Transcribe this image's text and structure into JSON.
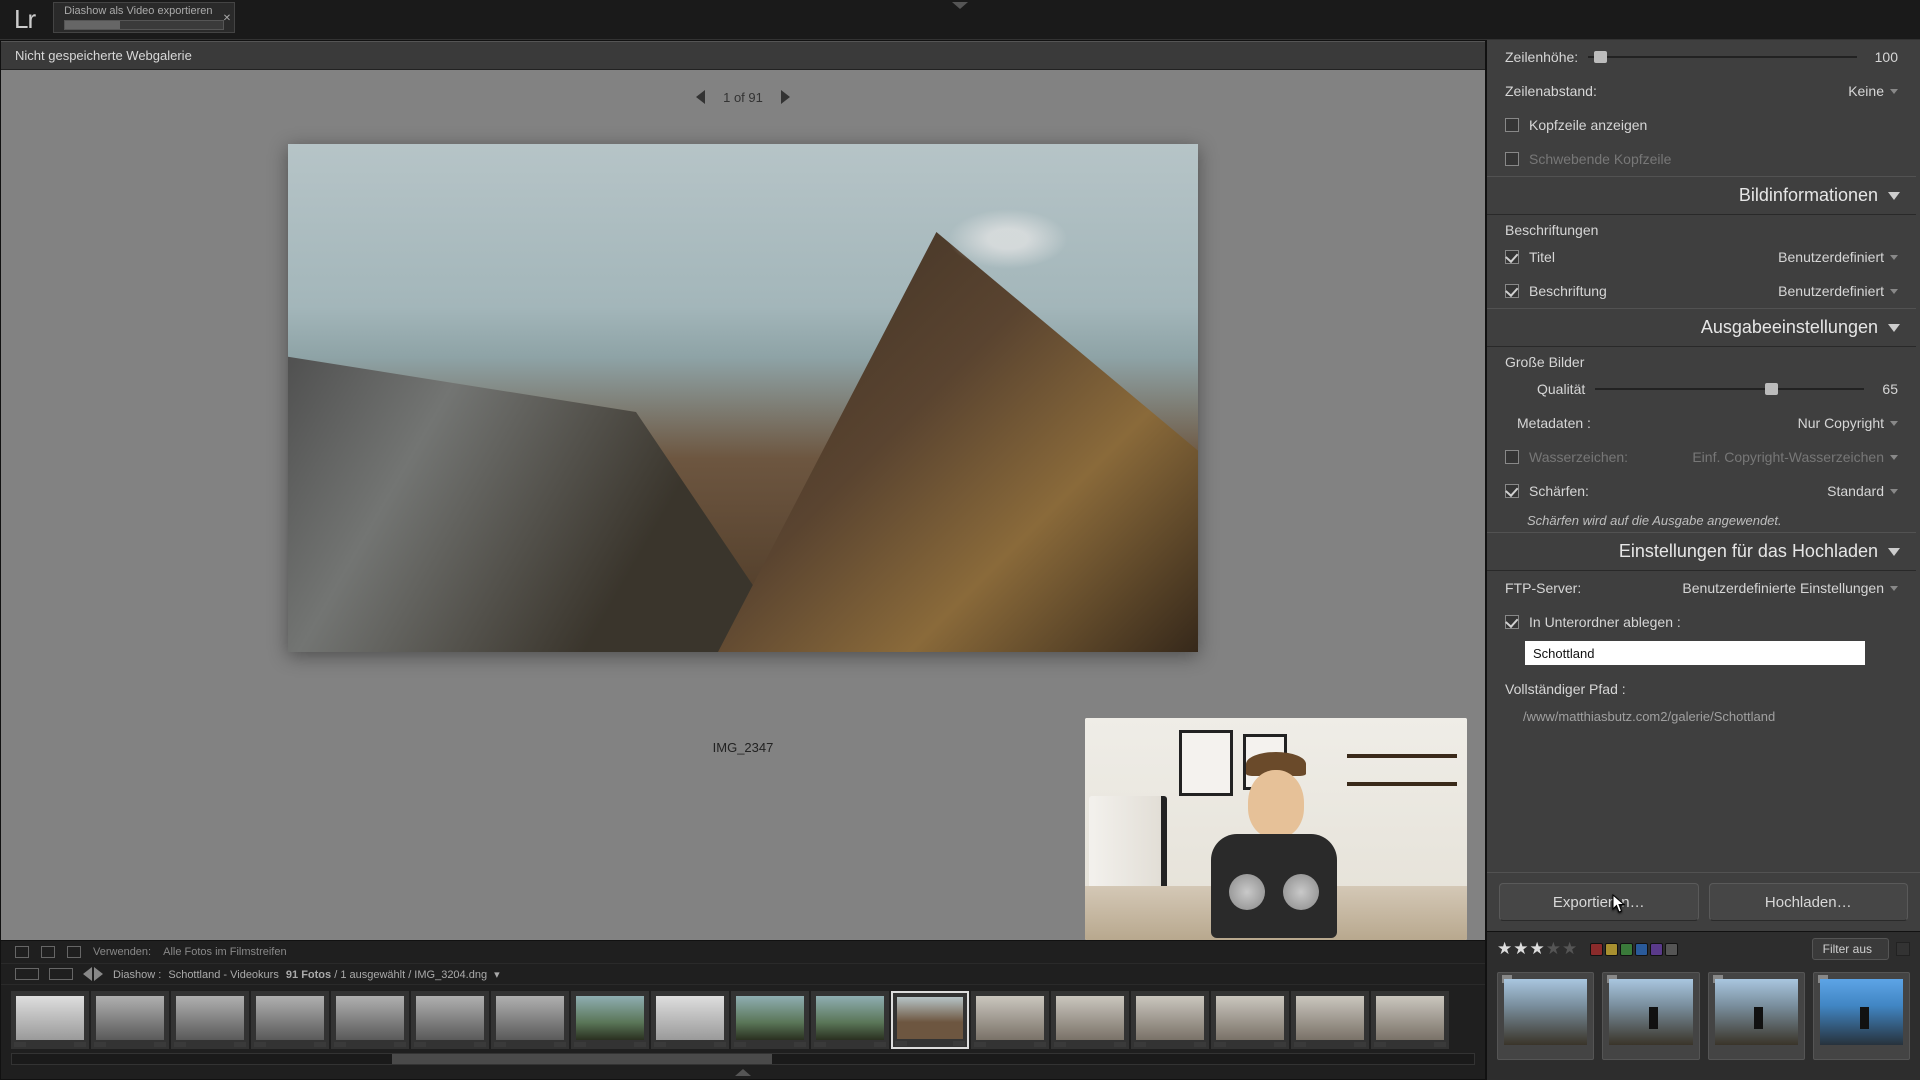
{
  "app": {
    "logo": "Lr",
    "export_task": "Diashow als Video exportieren",
    "top_collapse": "▾"
  },
  "gallery": {
    "unsaved_title": "Nicht gespeicherte Webgalerie",
    "pager_text": "1 of 91",
    "caption": "IMG_2347"
  },
  "panel": {
    "row_height_label": "Zeilenhöhe:",
    "row_height_value": "100",
    "row_spacing_label": "Zeilenabstand:",
    "row_spacing_value": "Keine",
    "show_header": "Kopfzeile anzeigen",
    "floating_header": "Schwebende Kopfzeile",
    "section_imageinfo": "Bildinformationen",
    "labels_head": "Beschriftungen",
    "title_label": "Titel",
    "title_value": "Benutzerdefiniert",
    "caption_label": "Beschriftung",
    "caption_value": "Benutzerdefiniert",
    "section_output": "Ausgabeeinstellungen",
    "large_head": "Große Bilder",
    "quality_label": "Qualität",
    "quality_value": "65",
    "metadata_label": "Metadaten :",
    "metadata_value": "Nur Copyright",
    "watermark_label": "Wasserzeichen:",
    "watermark_value": "Einf. Copyright-Wasserzeichen",
    "sharpen_label": "Schärfen:",
    "sharpen_value": "Standard",
    "sharpen_note": "Schärfen wird auf die Ausgabe angewendet.",
    "section_upload": "Einstellungen für das Hochladen",
    "ftp_label": "FTP-Server:",
    "ftp_value": "Benutzerdefinierte Einstellungen",
    "subfolder_label": "In Unterordner ablegen :",
    "subfolder_value": "Schottland",
    "fullpath_label": "Vollständiger Pfad :",
    "fullpath_value": "/www/matthiasbutz.com2/galerie/Schottland",
    "export_btn": "Exportieren…",
    "upload_btn": "Hochladen…",
    "filter_label": "Filter aus"
  },
  "strip": {
    "use_label": "Verwenden:",
    "use_value": "Alle Fotos im Filmstreifen",
    "crumb1": "Diashow :",
    "crumb2": "Schottland - Videokurs",
    "count_bold": "91 Fotos",
    "selected": "/ 1 ausgewählt / IMG_3204.dng",
    "star": "★"
  },
  "colors": {
    "chips": [
      "#8a2b2b",
      "#a89030",
      "#3a7a3a",
      "#2a5a9a",
      "#5a3a8a",
      "#888888"
    ]
  }
}
